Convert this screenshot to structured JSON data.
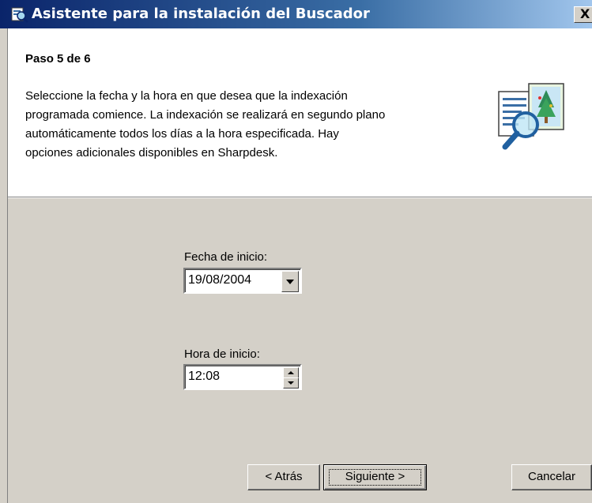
{
  "window": {
    "title": "Asistente para la instalación del Buscador",
    "close_glyph": "X"
  },
  "header": {
    "step": "Paso 5 de 6",
    "description_lines": [
      "Seleccione la fecha y la hora en que desea que la indexación",
      "programada comience. La indexación se realizará en segundo plano",
      "automáticamente todos los días a la hora especificada. Hay",
      "opciones adicionales disponibles en Sharpdesk."
    ],
    "icon": "search-document-icon"
  },
  "form": {
    "start_date_label": "Fecha de inicio:",
    "start_date_value": "19/08/2004",
    "start_time_label": "Hora de inicio:",
    "start_time_value": "12:08"
  },
  "buttons": {
    "back": "< Atrás",
    "next": "Siguiente >",
    "cancel": "Cancelar"
  },
  "colors": {
    "titlebar_start": "#0a246a",
    "titlebar_end": "#a6caf0",
    "dialog_face": "#d4d0c8",
    "header_bg": "#ffffff"
  }
}
